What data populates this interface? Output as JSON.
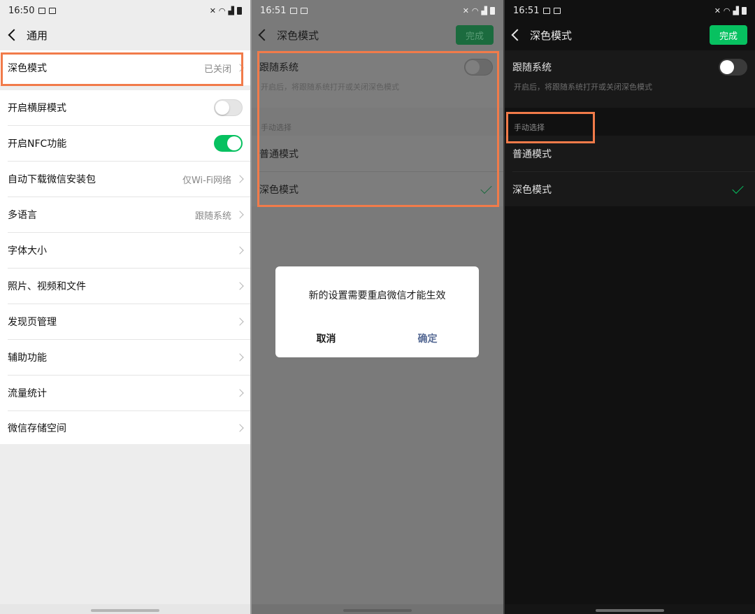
{
  "panels": [
    {
      "status": {
        "time": "16:50"
      },
      "nav": {
        "title": "通用"
      },
      "items": [
        {
          "label": "深色模式",
          "value": "已关闭"
        },
        {
          "label": "开启横屏模式",
          "toggle": false
        },
        {
          "label": "开启NFC功能",
          "toggle": true
        },
        {
          "label": "自动下载微信安装包",
          "value": "仅Wi-Fi网络"
        },
        {
          "label": "多语言",
          "value": "跟随系统"
        },
        {
          "label": "字体大小"
        },
        {
          "label": "照片、视频和文件"
        },
        {
          "label": "发现页管理"
        },
        {
          "label": "辅助功能"
        },
        {
          "label": "流量统计"
        },
        {
          "label": "微信存储空间"
        }
      ]
    },
    {
      "status": {
        "time": "16:51"
      },
      "nav": {
        "title": "深色模式",
        "done_label": "完成"
      },
      "follow_system": {
        "label": "跟随系统",
        "description": "开启后，将跟随系统打开或关闭深色模式",
        "toggle": false
      },
      "manual_section": "手动选择",
      "options": [
        {
          "label": "普通模式",
          "selected": false
        },
        {
          "label": "深色模式",
          "selected": true
        }
      ],
      "dialog": {
        "message": "新的设置需要重启微信才能生效",
        "cancel_label": "取消",
        "confirm_label": "确定"
      }
    },
    {
      "status": {
        "time": "16:51"
      },
      "nav": {
        "title": "深色模式",
        "done_label": "完成"
      },
      "follow_system": {
        "label": "跟随系统",
        "description": "开启后，将跟随系统打开或关闭深色模式",
        "toggle": false
      },
      "manual_section": "手动选择",
      "options": [
        {
          "label": "普通模式",
          "selected": false
        },
        {
          "label": "深色模式",
          "selected": true
        }
      ]
    }
  ],
  "colors": {
    "accent_green": "#07c160",
    "highlight_orange": "#f17b4a",
    "light_bg": "#ededed",
    "dark_bg": "#111111",
    "dark_cell": "#191919"
  },
  "icons": [
    "back-chevron-icon",
    "chevron-right-icon",
    "checkmark-icon",
    "wifi-icon",
    "signal-icon",
    "battery-icon",
    "mute-icon",
    "image-icon"
  ]
}
